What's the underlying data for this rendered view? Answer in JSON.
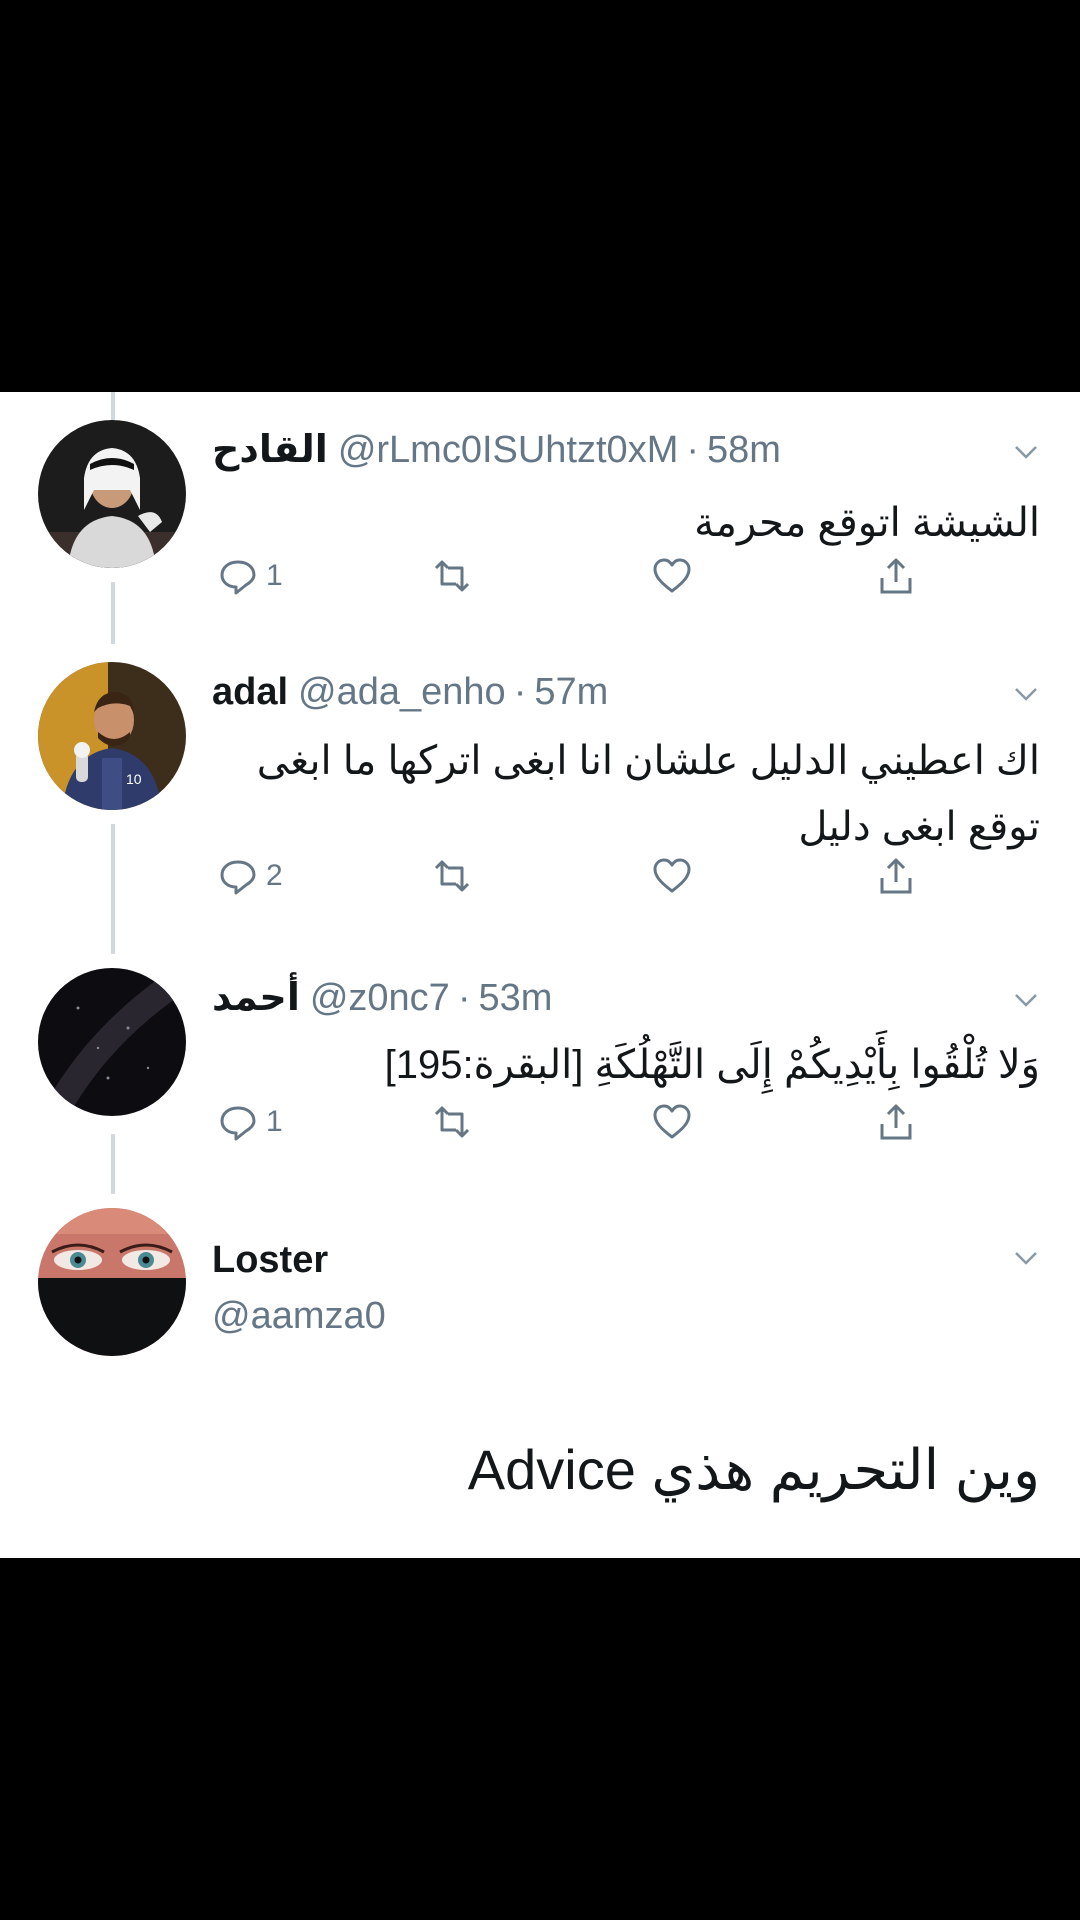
{
  "thread": [
    {
      "name": "القادح",
      "handle": "@rLmc0ISUhtzt0xM",
      "time": "58m",
      "text": "الشيشة اتوقع محرمة",
      "replies": "1",
      "avatar_icon": "person-ghutra-avatar"
    },
    {
      "name": "adal",
      "handle": "@ada_enho",
      "time": "57m",
      "text": "اك اعطيني الدليل علشان انا ابغى اتركها ما ابغى توقع ابغى دليل",
      "replies": "2",
      "avatar_icon": "soccer-player-avatar"
    },
    {
      "name": "أحمد",
      "handle": "@z0nc7",
      "time": "53m",
      "text": "وَلا تُلْقُوا بِأَيْدِيكُمْ إِلَى التَّهْلُكَةِ [البقرة:195]",
      "replies": "1",
      "avatar_icon": "starry-sky-avatar"
    }
  ],
  "reply_author": {
    "name": "Loster",
    "handle": "@aamza0",
    "text": "وين التحريم هذي Advice",
    "avatar_icon": "masked-eyes-avatar"
  },
  "colors": {
    "text": "#14171a",
    "muted": "#657786",
    "thread_line": "#cfd9de",
    "background": "#ffffff",
    "letterbox": "#000000"
  }
}
